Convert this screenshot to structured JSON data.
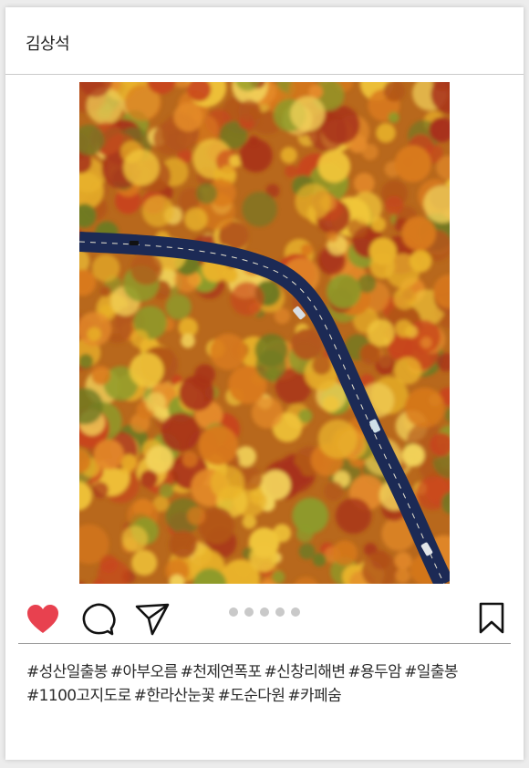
{
  "post": {
    "username": "김상석",
    "photo_description": "autumn-forest-road-aerial",
    "like_color": "#e8414f"
  },
  "actions": {
    "icons": [
      "heart-icon",
      "comment-icon",
      "share-icon",
      "bookmark-icon"
    ],
    "carousel": {
      "count": 5,
      "active_index": 0
    }
  },
  "tags": [
    "#성산일출봉",
    "#아부오름",
    "#천제연폭포",
    "#신창리해변",
    "#용두암",
    "#일출봉",
    "#1100고지도로",
    "#한라산눈꽃",
    "#도순다원",
    "#카페숨"
  ]
}
